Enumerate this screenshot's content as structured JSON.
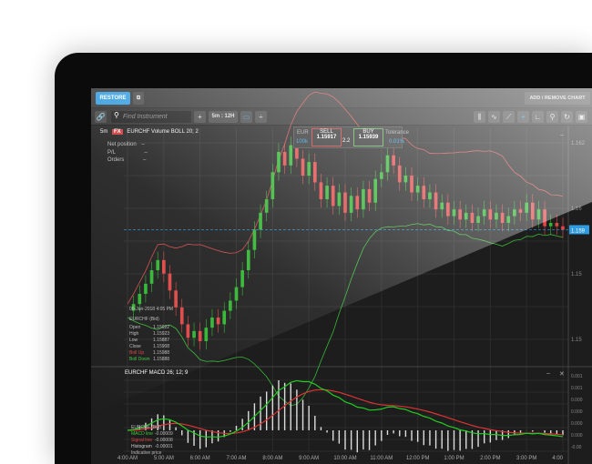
{
  "topbar": {
    "restore": "RESTORE",
    "add_remove": "ADD / REMOVE CHART"
  },
  "toolbar": {
    "search_placeholder": "Find Instrument",
    "interval": "5m : 12H"
  },
  "chart": {
    "timeframe": "5m",
    "badge": "FX",
    "title": "EURCHF  Volume  BOLL 20; 2",
    "collapse": "–",
    "position_labels": [
      {
        "label": "Net position",
        "value": "–"
      },
      {
        "label": "P/L",
        "value": "–"
      },
      {
        "label": "Orders",
        "value": "–"
      }
    ],
    "y_labels": [
      "1.162",
      "1.16",
      "1.15",
      "1.15"
    ],
    "current_price": "1.159",
    "tooltip": {
      "date": "08-Jun-2018 4:05 PM",
      "name": "EURCHF (Bid)",
      "rows": [
        {
          "label": "Open",
          "value": "1.15922"
        },
        {
          "label": "High",
          "value": "1.15923"
        },
        {
          "label": "Low",
          "value": "1.15887"
        },
        {
          "label": "Close",
          "value": "1.15908"
        },
        {
          "label": "Boll Up",
          "value": "1.15988",
          "color": "#e04040"
        },
        {
          "label": "Boll Down",
          "value": "1.15888",
          "color": "#3cc83c"
        }
      ]
    }
  },
  "trade": {
    "currency": "EUR",
    "amount": "100k",
    "sell_label": "SELL",
    "sell_price": "1.15917",
    "spread": "2.2",
    "buy_label": "BUY",
    "buy_price": "1.15939",
    "tolerance_label": "Tolerance",
    "tolerance": "0.01%"
  },
  "macd": {
    "title": "EURCHF  MACD 26; 12; 9",
    "minimize": "–",
    "close": "✕",
    "y_labels": [
      "0.001",
      "0.001",
      "0.000",
      "0.000",
      "0.000",
      "0.000",
      "-0.00"
    ],
    "legend": {
      "name": "EURCHF (Bid)",
      "rows": [
        {
          "label": "MACD line",
          "value": "-0.00009",
          "color": "#3cc83c"
        },
        {
          "label": "Signal line",
          "value": "-0.00008",
          "color": "#e04040"
        },
        {
          "label": "Histogram",
          "value": "-0.00001",
          "color": "#ccc"
        }
      ],
      "indicative": "Indicative price"
    }
  },
  "x_labels": [
    "4:00 AM",
    "5:00 AM",
    "6:00 AM",
    "7:00 AM",
    "8:00 AM",
    "9:00 AM",
    "10:00 AM",
    "11:00 AM",
    "12:00 PM",
    "1:00 PM",
    "2:00 PM",
    "3:00 PM",
    "4:00"
  ],
  "colors": {
    "accent": "#2f9be0",
    "up": "#2fb52f",
    "down": "#e04545",
    "boll_up": "#d04848",
    "boll_down": "#36b836"
  },
  "chart_data": {
    "type": "candlestick",
    "interval_minutes": 10,
    "start": "4:00 AM",
    "end": "4:00 PM",
    "closes": [
      1.1571,
      1.1573,
      1.1576,
      1.1579,
      1.1583,
      1.1586,
      1.1582,
      1.1577,
      1.1572,
      1.1567,
      1.1563,
      1.1565,
      1.1562,
      1.1566,
      1.1569,
      1.1567,
      1.1571,
      1.1574,
      1.1578,
      1.1583,
      1.1589,
      1.1595,
      1.16,
      1.1604,
      1.1612,
      1.1618,
      1.1614,
      1.162,
      1.1616,
      1.1611,
      1.1615,
      1.1609,
      1.1604,
      1.1608,
      1.1602,
      1.1606,
      1.16,
      1.1605,
      1.1601,
      1.1607,
      1.1603,
      1.161,
      1.1612,
      1.1617,
      1.1614,
      1.1609,
      1.1611,
      1.1606,
      1.1608,
      1.1604,
      1.1606,
      1.1601,
      1.1603,
      1.1599,
      1.1601,
      1.1598,
      1.16,
      1.1597,
      1.1599,
      1.1601,
      1.1598,
      1.16,
      1.1597,
      1.1599,
      1.1601,
      1.16,
      1.1603,
      1.1598,
      1.1601,
      1.1596,
      1.1597,
      1.1596,
      1.1595
    ],
    "ylim": [
      1.1555,
      1.1625
    ]
  }
}
